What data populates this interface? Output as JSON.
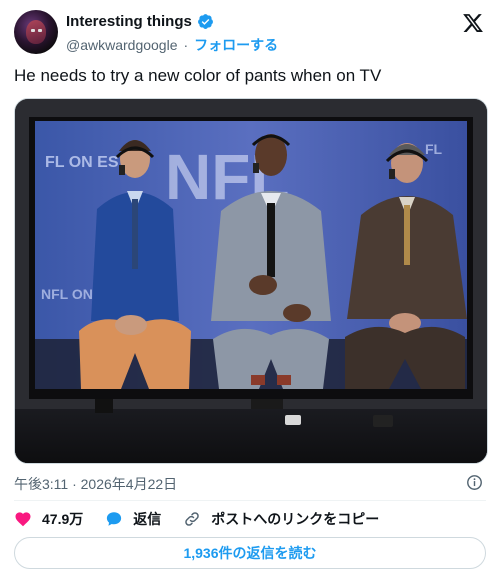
{
  "author": {
    "display_name": "Interesting things",
    "handle": "@awkwardgoogle",
    "follow_label": "フォローする",
    "verified_color": "#1d9bf0"
  },
  "tweet": {
    "text": "He needs to try a new color of pants when on TV",
    "timestamp": "午後3:11 · 2026年4月22日"
  },
  "media": {
    "screen_texts": [
      "FL ON ES",
      "NFL",
      "FL",
      "NFL ON"
    ]
  },
  "actions": {
    "likes": "47.9万",
    "reply_label": "返信",
    "copy_link_label": "ポストへのリンクをコピー",
    "read_replies_label": "1,936件の返信を読む"
  },
  "colors": {
    "accent": "#1d9bf0",
    "like": "#f91880",
    "text": "#0f1419",
    "muted": "#536471"
  }
}
